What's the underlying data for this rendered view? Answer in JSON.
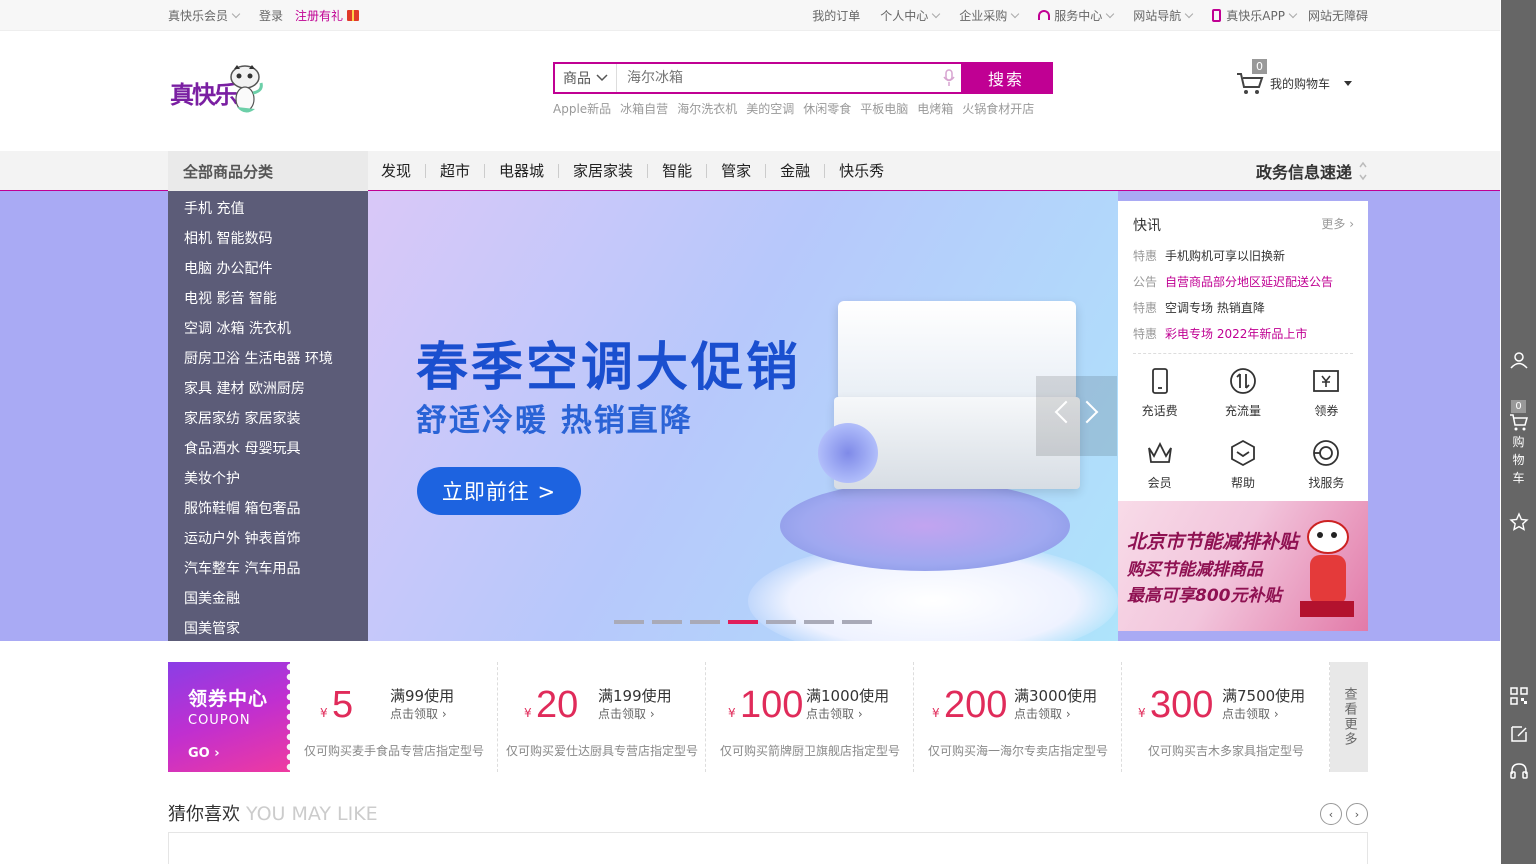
{
  "topbar": {
    "member": "真快乐会员",
    "login": "登录",
    "register": "注册有礼",
    "links": [
      "我的订单",
      "个人中心",
      "企业采购",
      "服务中心",
      "网站导航",
      "真快乐APP",
      "网站无障碍"
    ]
  },
  "header": {
    "logo": "真快乐",
    "search_category": "商品",
    "search_placeholder": "海尔冰箱",
    "search_button": "搜索",
    "hotwords": [
      "Apple新品",
      "冰箱自营",
      "海尔洗衣机",
      "美的空调",
      "休闲零食",
      "平板电脑",
      "电烤箱",
      "火锅食材开店"
    ],
    "cart_count": "0",
    "cart_label": "我的购物车"
  },
  "nav": {
    "all_categories": "全部商品分类",
    "items": [
      "发现",
      "超市",
      "电器城",
      "家居家装",
      "智能",
      "管家",
      "金融",
      "快乐秀"
    ],
    "gov": "政务信息速递"
  },
  "categories": [
    "手机 充值",
    "相机 智能数码",
    "电脑 办公配件",
    "电视 影音 智能",
    "空调 冰箱 洗衣机",
    "厨房卫浴 生活电器 环境",
    "家具 建材 欧洲厨房",
    "家居家纺 家居家装",
    "食品酒水 母婴玩具",
    "美妆个护",
    "服饰鞋帽 箱包奢品",
    "运动户外 钟表首饰",
    "汽车整车 汽车用品",
    "国美金融",
    "国美管家"
  ],
  "banner": {
    "title": "春季空调大促销",
    "subtitle": "舒适冷暖 热销直降",
    "button": "立即前往 >",
    "active_dot": 3,
    "dot_count": 7
  },
  "news": {
    "title": "快讯",
    "more": "更多",
    "items": [
      {
        "tag": "特惠",
        "text": "手机购机可享以旧换新",
        "highlight": false
      },
      {
        "tag": "公告",
        "text": "自营商品部分地区延迟配送公告",
        "highlight": true
      },
      {
        "tag": "特惠",
        "text": "空调专场 热销直降",
        "highlight": false
      },
      {
        "tag": "特惠",
        "text": "彩电专场 2022年新品上市",
        "highlight": true
      }
    ]
  },
  "services": [
    {
      "label": "充话费",
      "icon": "phone-icon"
    },
    {
      "label": "充流量",
      "icon": "data-icon"
    },
    {
      "label": "领券",
      "icon": "coupon-icon"
    },
    {
      "label": "会员",
      "icon": "crown-icon"
    },
    {
      "label": "帮助",
      "icon": "help-icon"
    },
    {
      "label": "找服务",
      "icon": "service-icon"
    }
  ],
  "promo": {
    "line1": "北京市节能减排补贴",
    "line2": "购买节能减排商品",
    "line3": "最高可享800元补贴"
  },
  "coupons": {
    "title": "领券中心",
    "title_en": "COUPON",
    "go": "GO",
    "currency": "¥",
    "get": "点击领取",
    "more": "查看更多",
    "items": [
      {
        "amount": "5",
        "cond": "满99使用",
        "desc": "仅可购买麦手食品专营店指定型号"
      },
      {
        "amount": "20",
        "cond": "满199使用",
        "desc": "仅可购买爱仕达厨具专营店指定型号"
      },
      {
        "amount": "100",
        "cond": "满1000使用",
        "desc": "仅可购买箭牌厨卫旗舰店指定型号"
      },
      {
        "amount": "200",
        "cond": "满3000使用",
        "desc": "仅可购买海一海尔专卖店指定型号"
      },
      {
        "amount": "300",
        "cond": "满7500使用",
        "desc": "仅可购买吉木多家具指定型号"
      }
    ]
  },
  "guess": {
    "title": "猜你喜欢",
    "title_en": "YOU MAY LIKE"
  },
  "sidebar": {
    "cart_count": "0",
    "cart_label": "购物车"
  },
  "colors": {
    "brand": "#c00093",
    "banner_bg": "#a9aaf4",
    "category_bg": "#5c5c78",
    "coupon_red": "#e02b5a"
  }
}
